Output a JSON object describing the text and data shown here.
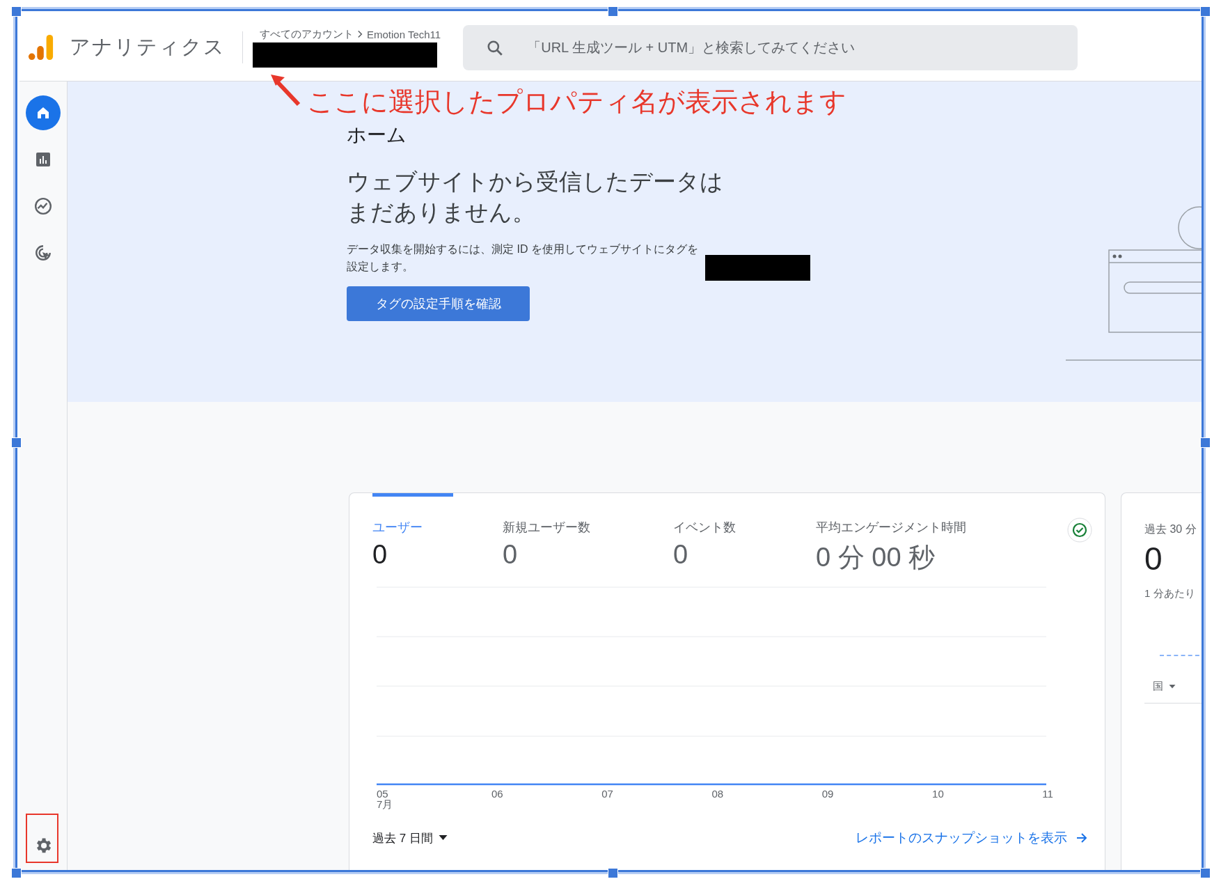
{
  "header": {
    "app_name": "アナリティクス",
    "breadcrumb": [
      "すべてのアカウント",
      "Emotion Tech11"
    ],
    "search": {
      "placeholder": "「URL 生成ツール + UTM」と検索してみてください"
    }
  },
  "annotation": {
    "text": "ここに選択したプロパティ名が表示されます"
  },
  "sidebar": {
    "items": [
      {
        "selected": true
      },
      {
        "selected": false
      },
      {
        "selected": false
      },
      {
        "selected": false
      }
    ]
  },
  "hero": {
    "title": "ホーム",
    "heading": [
      "ウェブサイトから受信したデータは",
      "まだありません。"
    ],
    "body": "データ収集を開始するには、測定 ID を使用してウェブサイトにタグを設定します。",
    "button": "タグの設定手順を確認"
  },
  "metrics": [
    {
      "label": "ユーザー",
      "value": "0",
      "selected": true
    },
    {
      "label": "新規ユーザー数",
      "value": "0",
      "selected": false
    },
    {
      "label": "イベント数",
      "value": "0",
      "selected": false
    },
    {
      "label": "平均エンゲージメント時間",
      "value": "0 分 00 秒",
      "selected": false
    }
  ],
  "chart": {
    "x_labels": [
      "05",
      "06",
      "07",
      "08",
      "09",
      "10",
      "11"
    ],
    "month": "7月"
  },
  "card_footer": {
    "range": "過去 7 日間",
    "link": "レポートのスナップショットを表示"
  },
  "realtime": {
    "title": "過去 30 分",
    "value": "0",
    "subtitle": "1 分あたり",
    "dropdown": "国"
  }
}
